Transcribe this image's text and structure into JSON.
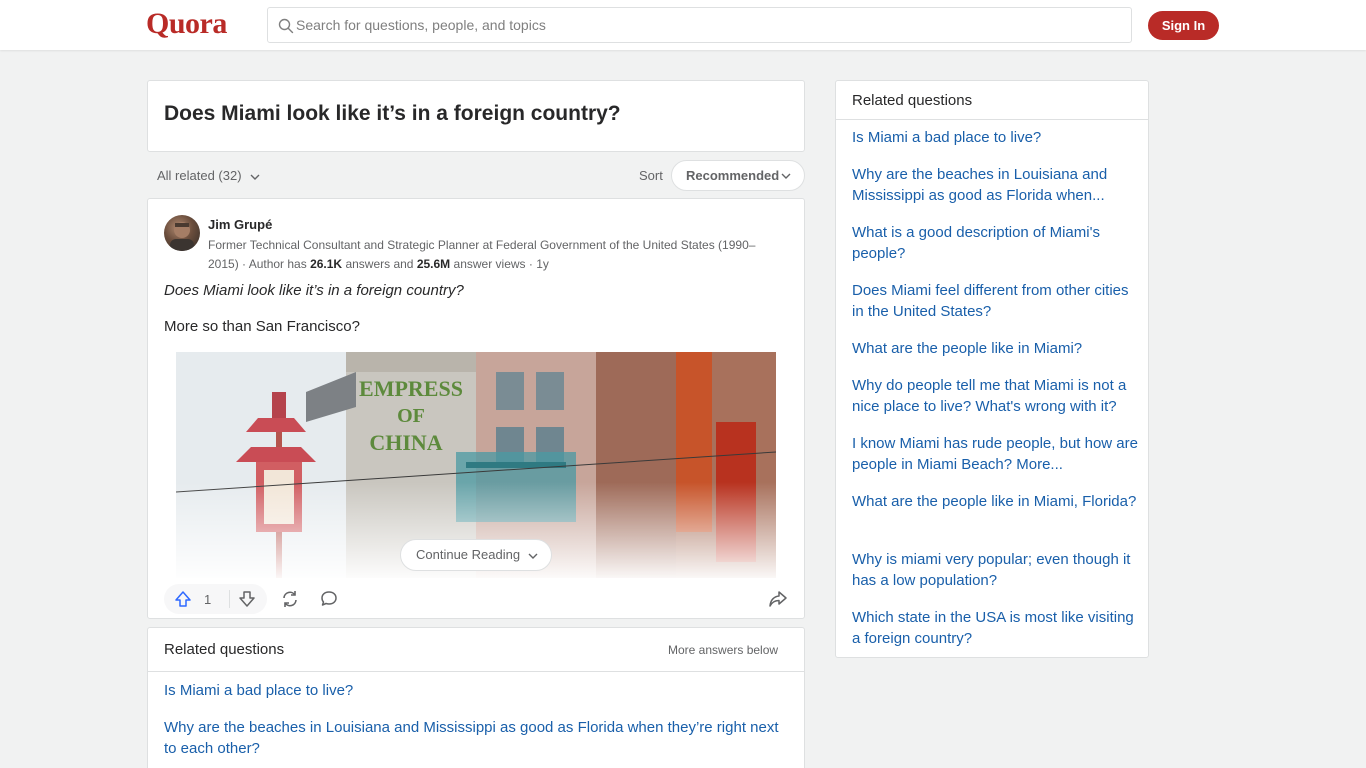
{
  "header": {
    "logo": "Quora",
    "search_placeholder": "Search for questions, people, and topics",
    "signin_label": "Sign In"
  },
  "question": {
    "title": "Does Miami look like it’s in a foreign country?"
  },
  "filters": {
    "all_related": "All related (32)",
    "sort_label": "Sort",
    "sort_value": "Recommended"
  },
  "answer": {
    "author": "Jim Grupé",
    "credential_prefix": "Former Technical Consultant and Strategic Planner at Federal Government of the United States (1990–2015) · Author has ",
    "answers_count": "26.1K",
    "answers_text": " answers and ",
    "views_count": "25.6M",
    "views_text": " answer views · 1y",
    "quote": "Does Miami look like it’s in a foreign country?",
    "body": "More so than San Francisco?",
    "image_text_line1": "EMPRESS",
    "image_text_line2": "OF",
    "image_text_line3": "CHINA",
    "continue_label": "Continue Reading",
    "upvotes": "1"
  },
  "related_main": {
    "heading": "Related questions",
    "more_below": "More answers below",
    "items": [
      "Is Miami a bad place to live?",
      "Why are the beaches in Louisiana and Mississippi as good as Florida when they’re right next to each other?"
    ]
  },
  "related_side": {
    "heading": "Related questions",
    "items": [
      "Is Miami a bad place to live?",
      "Why are the beaches in Louisiana and Mississippi as good as Florida when...",
      "What is a good description of Miami's people?",
      "Does Miami feel different from other cities in the United States?",
      "What are the people like in Miami?",
      "Why do people tell me that Miami is not a nice place to live? What's wrong with it?",
      "I know Miami has rude people, but how are people in Miami Beach? More...",
      "What are the people like in Miami, Florida?",
      "Why is miami very popular; even though it has a low population?",
      "Which state in the USA is most like visiting a foreign country?"
    ]
  },
  "colors": {
    "brand": "#b92b27",
    "link": "#195faa",
    "background": "#f1f2f2"
  }
}
